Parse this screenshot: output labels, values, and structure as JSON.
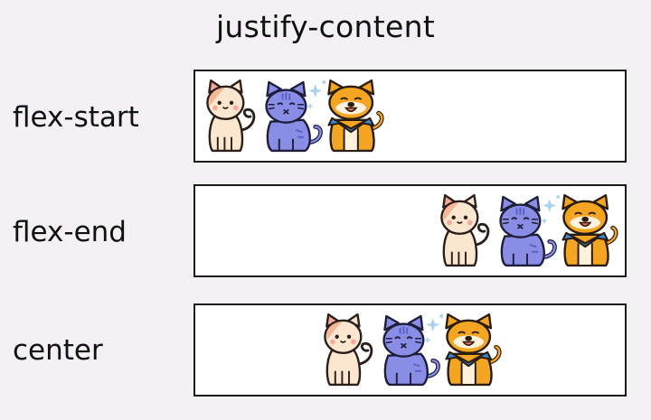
{
  "title": "justify-content",
  "rows": [
    {
      "label": "flex-start",
      "justify": "start"
    },
    {
      "label": "flex-end",
      "justify": "end"
    },
    {
      "label": "center",
      "justify": "center"
    }
  ],
  "animals": [
    {
      "name": "cat-icon",
      "colors": {
        "fill": "#fbe7cf",
        "face": "#fbe7cf",
        "ear": "#f4a79b"
      }
    },
    {
      "name": "purple-cat-icon",
      "colors": {
        "fill": "#8a8de6",
        "stripe": "#5c5fc2",
        "sparkle": "#a9d3ec"
      }
    },
    {
      "name": "dog-icon",
      "colors": {
        "fill": "#f4a623",
        "face": "#fff1dc",
        "scarf": "#3a8bd6"
      }
    }
  ],
  "colors": {
    "background": "#f4f1f5",
    "outline": "#1a1a1a"
  }
}
